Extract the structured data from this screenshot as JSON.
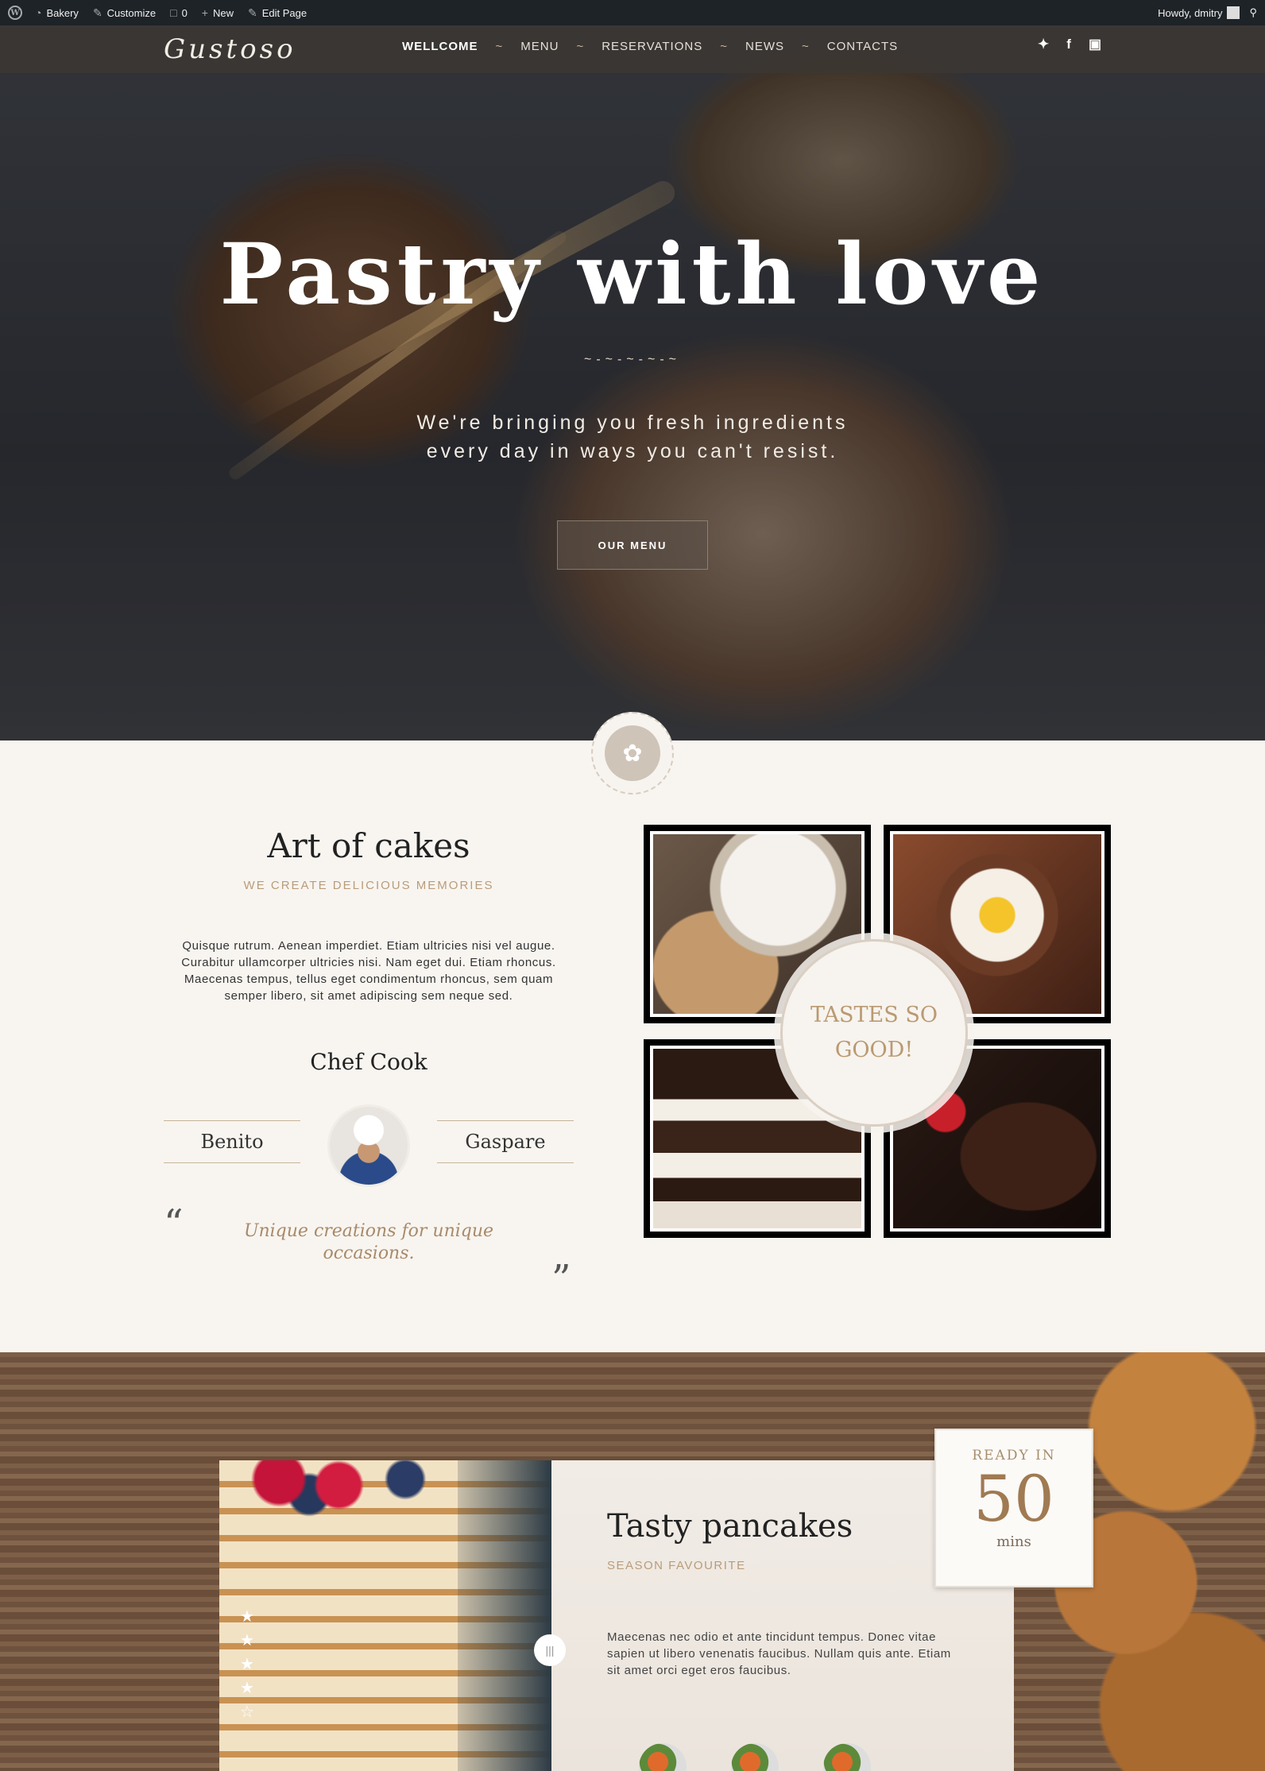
{
  "adminbar": {
    "site": "Bakery",
    "customize": "Customize",
    "comments": "0",
    "new": "New",
    "edit": "Edit Page",
    "howdy": "Howdy, dmitry"
  },
  "nav": {
    "logo": "Gustoso",
    "items": [
      "WELLCOME",
      "MENU",
      "RESERVATIONS",
      "NEWS",
      "CONTACTS"
    ],
    "separator": "~"
  },
  "hero": {
    "title": "Pastry with love",
    "divider": "~-~-~-~-~",
    "subtitle_line1": "We're bringing you fresh ingredients",
    "subtitle_line2": "every day in ways you can't resist.",
    "button": "OUR MENU"
  },
  "about": {
    "title": "Art of cakes",
    "subtitle": "WE CREATE DELICIOUS MEMORIES",
    "text": "Quisque rutrum. Aenean imperdiet. Etiam ultricies nisi vel augue. Curabitur ullamcorper ultricies nisi. Nam eget dui. Etiam rhoncus. Maecenas tempus, tellus eget condimentum rhoncus, sem quam semper libero, sit amet adipiscing sem neque sed.",
    "chef_title": "Chef Cook",
    "chef_first": "Benito",
    "chef_last": "Gaspare",
    "quote_open": "“",
    "quote": "Unique creations for unique occasions.",
    "quote_close": "”",
    "seal_line1": "TASTES SO",
    "seal_line2": "GOOD!"
  },
  "feature": {
    "title": "Tasty pancakes",
    "subtitle": "SEASON FAVOURITE",
    "text": "Maecenas nec odio et ante tincidunt tempus. Donec vitae sapien ut libero venenatis faucibus. Nullam quis ante. Etiam sit amet orci eget eros faucibus.",
    "ready_label": "READY IN",
    "ready_value": "50",
    "ready_unit": "mins",
    "rating": 4,
    "rating_max": 5
  }
}
